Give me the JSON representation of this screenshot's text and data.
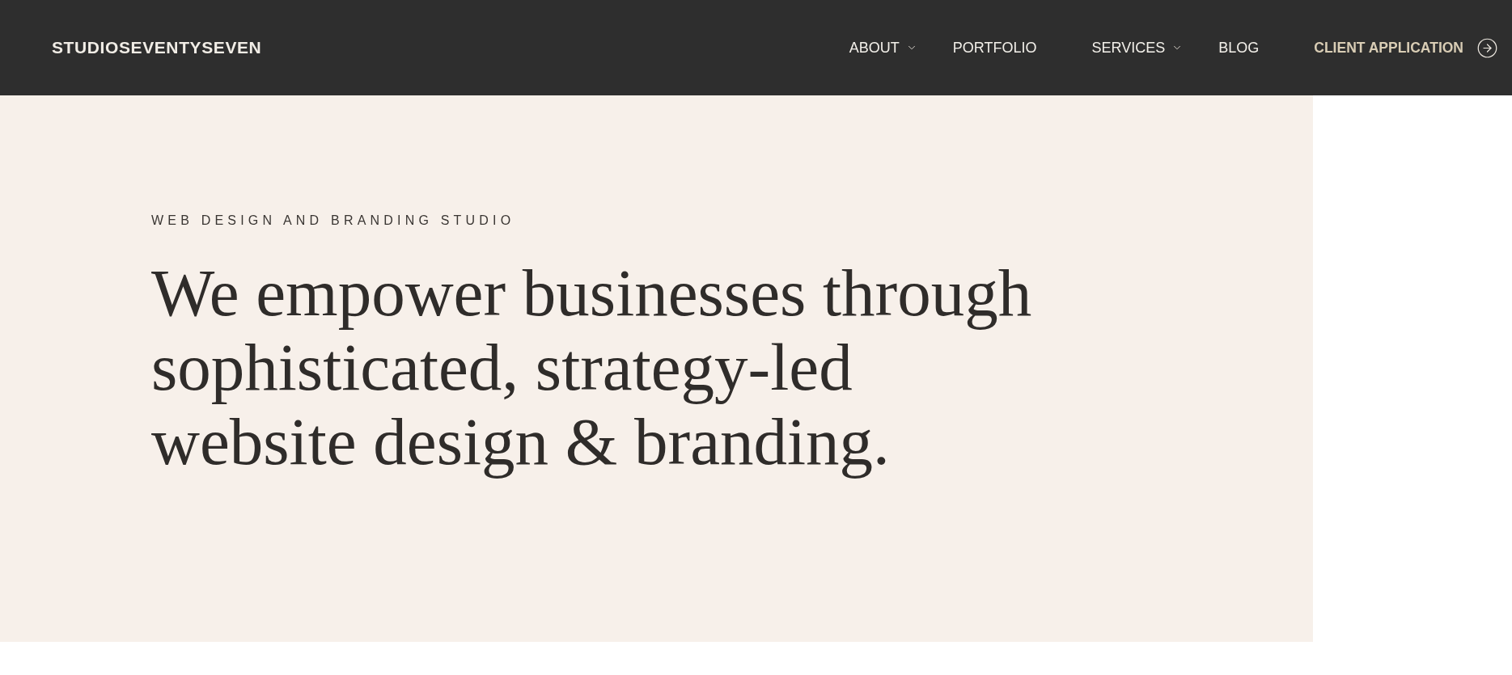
{
  "brand": {
    "name": "STUDIOSEVENTYSEVEN"
  },
  "nav": {
    "items": [
      {
        "label": "ABOUT",
        "dropdown": true
      },
      {
        "label": "PORTFOLIO",
        "dropdown": false
      },
      {
        "label": "SERVICES",
        "dropdown": true
      },
      {
        "label": "BLOG",
        "dropdown": false
      }
    ],
    "cta": {
      "label": "CLIENT APPLICATION"
    }
  },
  "hero": {
    "eyebrow": "WEB DESIGN AND BRANDING STUDIO",
    "headline": "We empower businesses through sophisticated, strategy-led website design & branding."
  }
}
